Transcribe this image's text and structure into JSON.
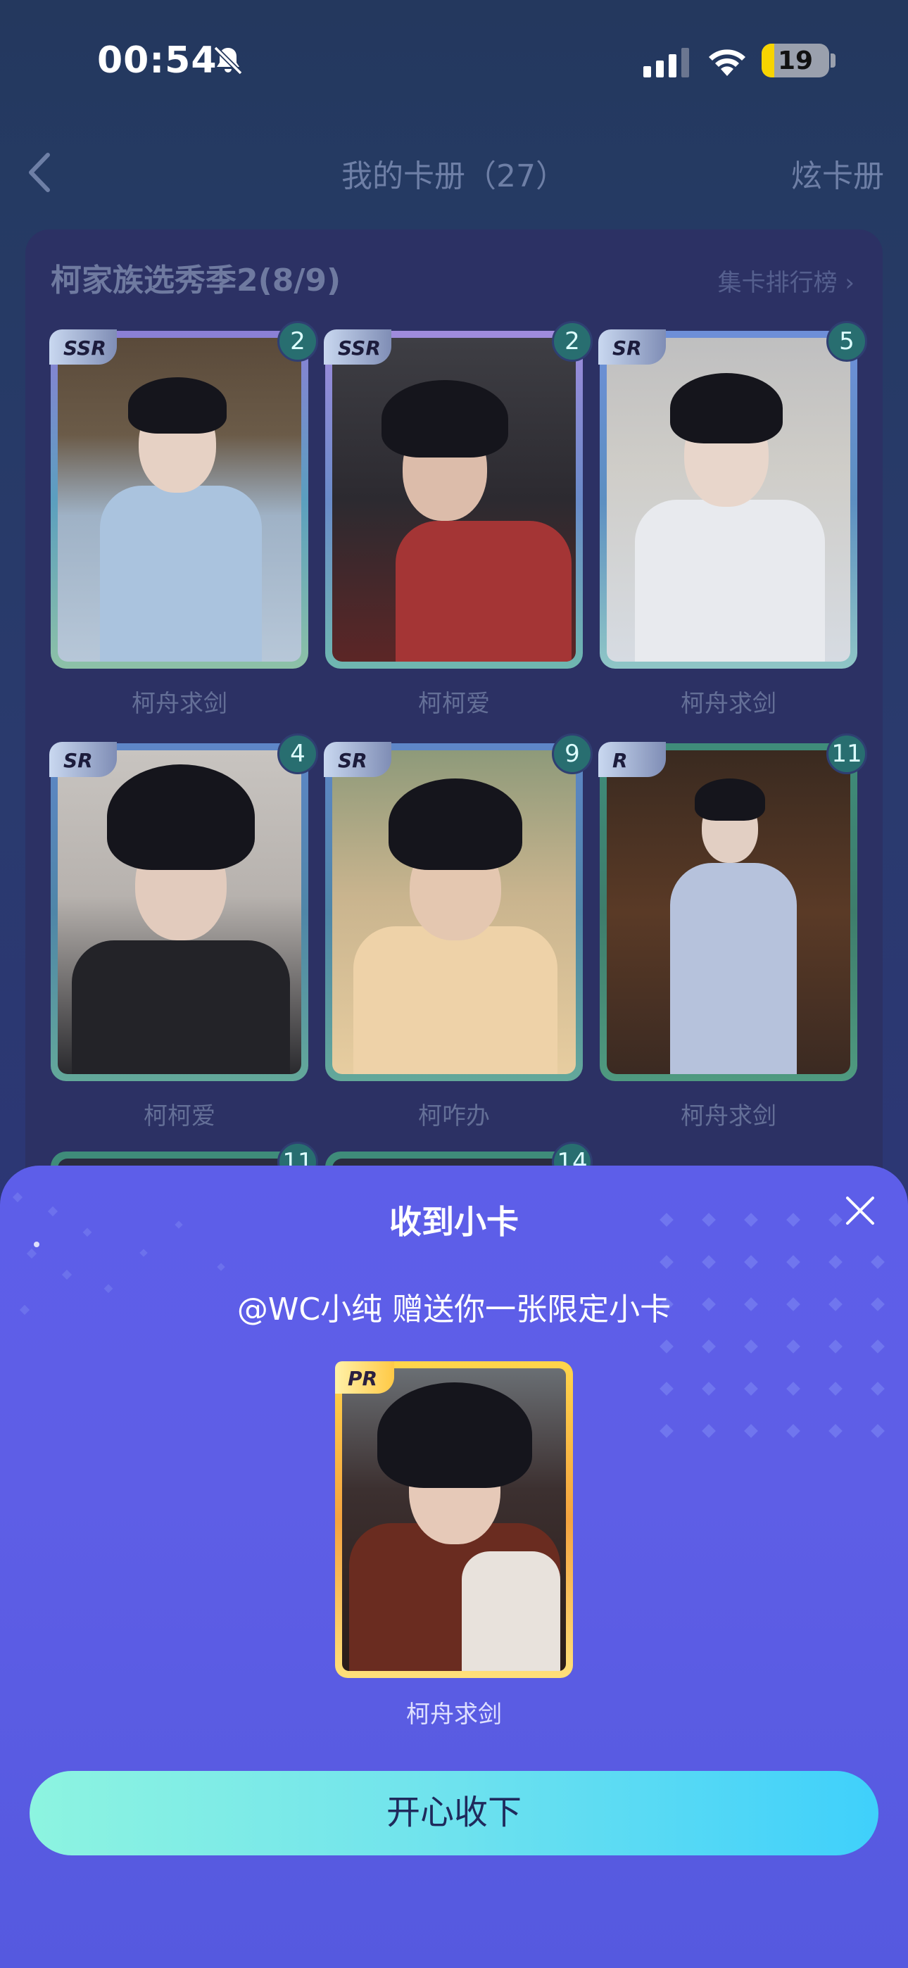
{
  "status_bar": {
    "time": "00:54",
    "battery": "19",
    "battery_level_percent": 19,
    "icons": [
      "bell-slash-icon",
      "signal-icon",
      "wifi-icon",
      "battery-icon"
    ]
  },
  "nav": {
    "back_icon": "chevron-left-icon",
    "title": "我的卡册（27）",
    "right_action": "炫卡册"
  },
  "album": {
    "title": "柯家族选秀季2(8/9)",
    "rank_link": "集卡排行榜",
    "rank_icon": "chevron-right-icon",
    "cards": [
      {
        "rarity": "SSR",
        "count": "2",
        "label": "柯舟求剑"
      },
      {
        "rarity": "SSR",
        "count": "2",
        "label": "柯柯爱"
      },
      {
        "rarity": "SR",
        "count": "5",
        "label": "柯舟求剑"
      },
      {
        "rarity": "SR",
        "count": "4",
        "label": "柯柯爱"
      },
      {
        "rarity": "SR",
        "count": "9",
        "label": "柯咋办"
      },
      {
        "rarity": "R",
        "count": "11",
        "label": "柯舟求剑"
      },
      {
        "rarity": "",
        "count": "11",
        "label": ""
      },
      {
        "rarity": "",
        "count": "14",
        "label": ""
      }
    ]
  },
  "gift_sheet": {
    "title": "收到小卡",
    "close_icon": "close-icon",
    "message": "@WC小纯 赠送你一张限定小卡",
    "card": {
      "rarity": "PR",
      "label": "柯舟求剑"
    },
    "accept_button": "开心收下"
  },
  "colors": {
    "sheet_bg": "#5d5ee9",
    "button_gradient_start": "#8df4e0",
    "button_gradient_end": "#3fd0fb",
    "badge_bg": "#286e70"
  }
}
